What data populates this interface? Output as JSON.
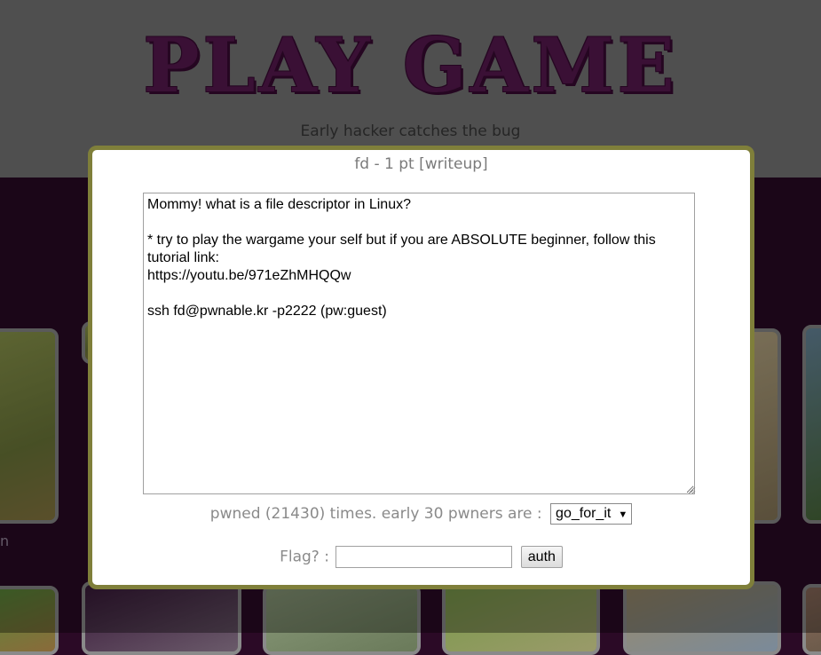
{
  "page": {
    "logo_text": "PLAY GAME",
    "tagline": "Early hacker catches the bug",
    "bg_caption_fragment": "n"
  },
  "modal": {
    "title": "fd - 1 pt [writeup]",
    "description": "Mommy! what is a file descriptor in Linux?\n\n* try to play the wargame your self but if you are ABSOLUTE beginner, follow this tutorial link:\nhttps://youtu.be/971eZhMHQQw\n\nssh fd@pwnable.kr -p2222 (pw:guest)",
    "pwned_text": "pwned (21430) times. early 30 pwners are :",
    "pwners_selected": "go_for_it",
    "flag_label": "Flag? :",
    "flag_value": "",
    "auth_label": "auth"
  },
  "colors": {
    "modal_border": "#7f7f3a",
    "background": "#2b0a26",
    "logo": "#5a1a52"
  }
}
